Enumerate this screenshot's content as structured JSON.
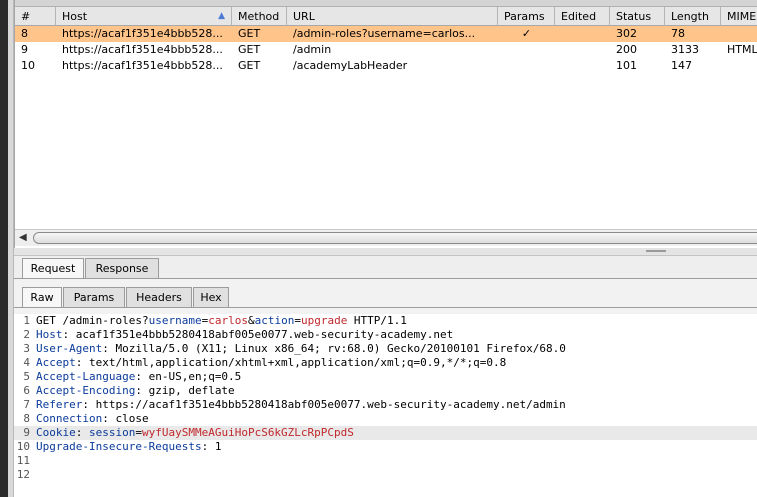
{
  "table": {
    "columns": [
      {
        "key": "num",
        "label": "#"
      },
      {
        "key": "host",
        "label": "Host"
      },
      {
        "key": "method",
        "label": "Method"
      },
      {
        "key": "url",
        "label": "URL"
      },
      {
        "key": "params",
        "label": "Params"
      },
      {
        "key": "edited",
        "label": "Edited"
      },
      {
        "key": "status",
        "label": "Status"
      },
      {
        "key": "length",
        "label": "Length"
      },
      {
        "key": "mime",
        "label": "MIME"
      }
    ],
    "rows": [
      {
        "num": "8",
        "host": "https://acaf1f351e4bbb528...",
        "method": "GET",
        "url": "/admin-roles?username=carlos...",
        "params": "✓",
        "edited": "",
        "status": "302",
        "length": "78",
        "mime": ""
      },
      {
        "num": "9",
        "host": "https://acaf1f351e4bbb528...",
        "method": "GET",
        "url": "/admin",
        "params": "",
        "edited": "",
        "status": "200",
        "length": "3133",
        "mime": "HTML"
      },
      {
        "num": "10",
        "host": "https://acaf1f351e4bbb528...",
        "method": "GET",
        "url": "/academyLabHeader",
        "params": "",
        "edited": "",
        "status": "101",
        "length": "147",
        "mime": ""
      }
    ],
    "selected_row": 0,
    "sort_icon": "triangle-up-icon"
  },
  "tabs_outer": [
    "Request",
    "Response"
  ],
  "tabs_inner": [
    "Raw",
    "Params",
    "Headers",
    "Hex"
  ],
  "request_lines": [
    {
      "n": "1",
      "parts": [
        {
          "t": "GET /admin-roles?"
        },
        {
          "t": "username",
          "c": "k"
        },
        {
          "t": "="
        },
        {
          "t": "carlos",
          "c": "v"
        },
        {
          "t": "&"
        },
        {
          "t": "action",
          "c": "k"
        },
        {
          "t": "="
        },
        {
          "t": "upgrade",
          "c": "v"
        },
        {
          "t": " HTTP/1.1"
        }
      ]
    },
    {
      "n": "2",
      "parts": [
        {
          "t": "Host",
          "c": "k"
        },
        {
          "t": ": acaf1f351e4bbb5280418abf005e0077.web-security-academy.net"
        }
      ]
    },
    {
      "n": "3",
      "parts": [
        {
          "t": "User-Agent",
          "c": "k"
        },
        {
          "t": ": Mozilla/5.0 (X11; Linux x86_64; rv:68.0) Gecko/20100101 Firefox/68.0"
        }
      ]
    },
    {
      "n": "4",
      "parts": [
        {
          "t": "Accept",
          "c": "k"
        },
        {
          "t": ": text/html,application/xhtml+xml,application/xml;q=0.9,*/*;q=0.8"
        }
      ]
    },
    {
      "n": "5",
      "parts": [
        {
          "t": "Accept-Language",
          "c": "k"
        },
        {
          "t": ": en-US,en;q=0.5"
        }
      ]
    },
    {
      "n": "6",
      "parts": [
        {
          "t": "Accept-Encoding",
          "c": "k"
        },
        {
          "t": ": gzip, deflate"
        }
      ]
    },
    {
      "n": "7",
      "parts": [
        {
          "t": "Referer",
          "c": "k"
        },
        {
          "t": ": https://acaf1f351e4bbb5280418abf005e0077.web-security-academy.net/admin"
        }
      ]
    },
    {
      "n": "8",
      "parts": [
        {
          "t": "Connection",
          "c": "k"
        },
        {
          "t": ": close"
        }
      ]
    },
    {
      "n": "9",
      "highlight": true,
      "parts": [
        {
          "t": "Cookie",
          "c": "k"
        },
        {
          "t": ": "
        },
        {
          "t": "session",
          "c": "k"
        },
        {
          "t": "="
        },
        {
          "t": "wyfUaySMMeAGuiHoPcS6kGZLcRpPCpdS",
          "c": "v"
        }
      ]
    },
    {
      "n": "10",
      "parts": [
        {
          "t": "Upgrade-Insecure-Requests",
          "c": "k"
        },
        {
          "t": ": 1"
        }
      ]
    },
    {
      "n": "11",
      "parts": []
    },
    {
      "n": "12",
      "parts": []
    }
  ],
  "colors": {
    "selected_row": "#ffc48a",
    "keyword": "#0b3b9b",
    "value": "#c0282c"
  }
}
